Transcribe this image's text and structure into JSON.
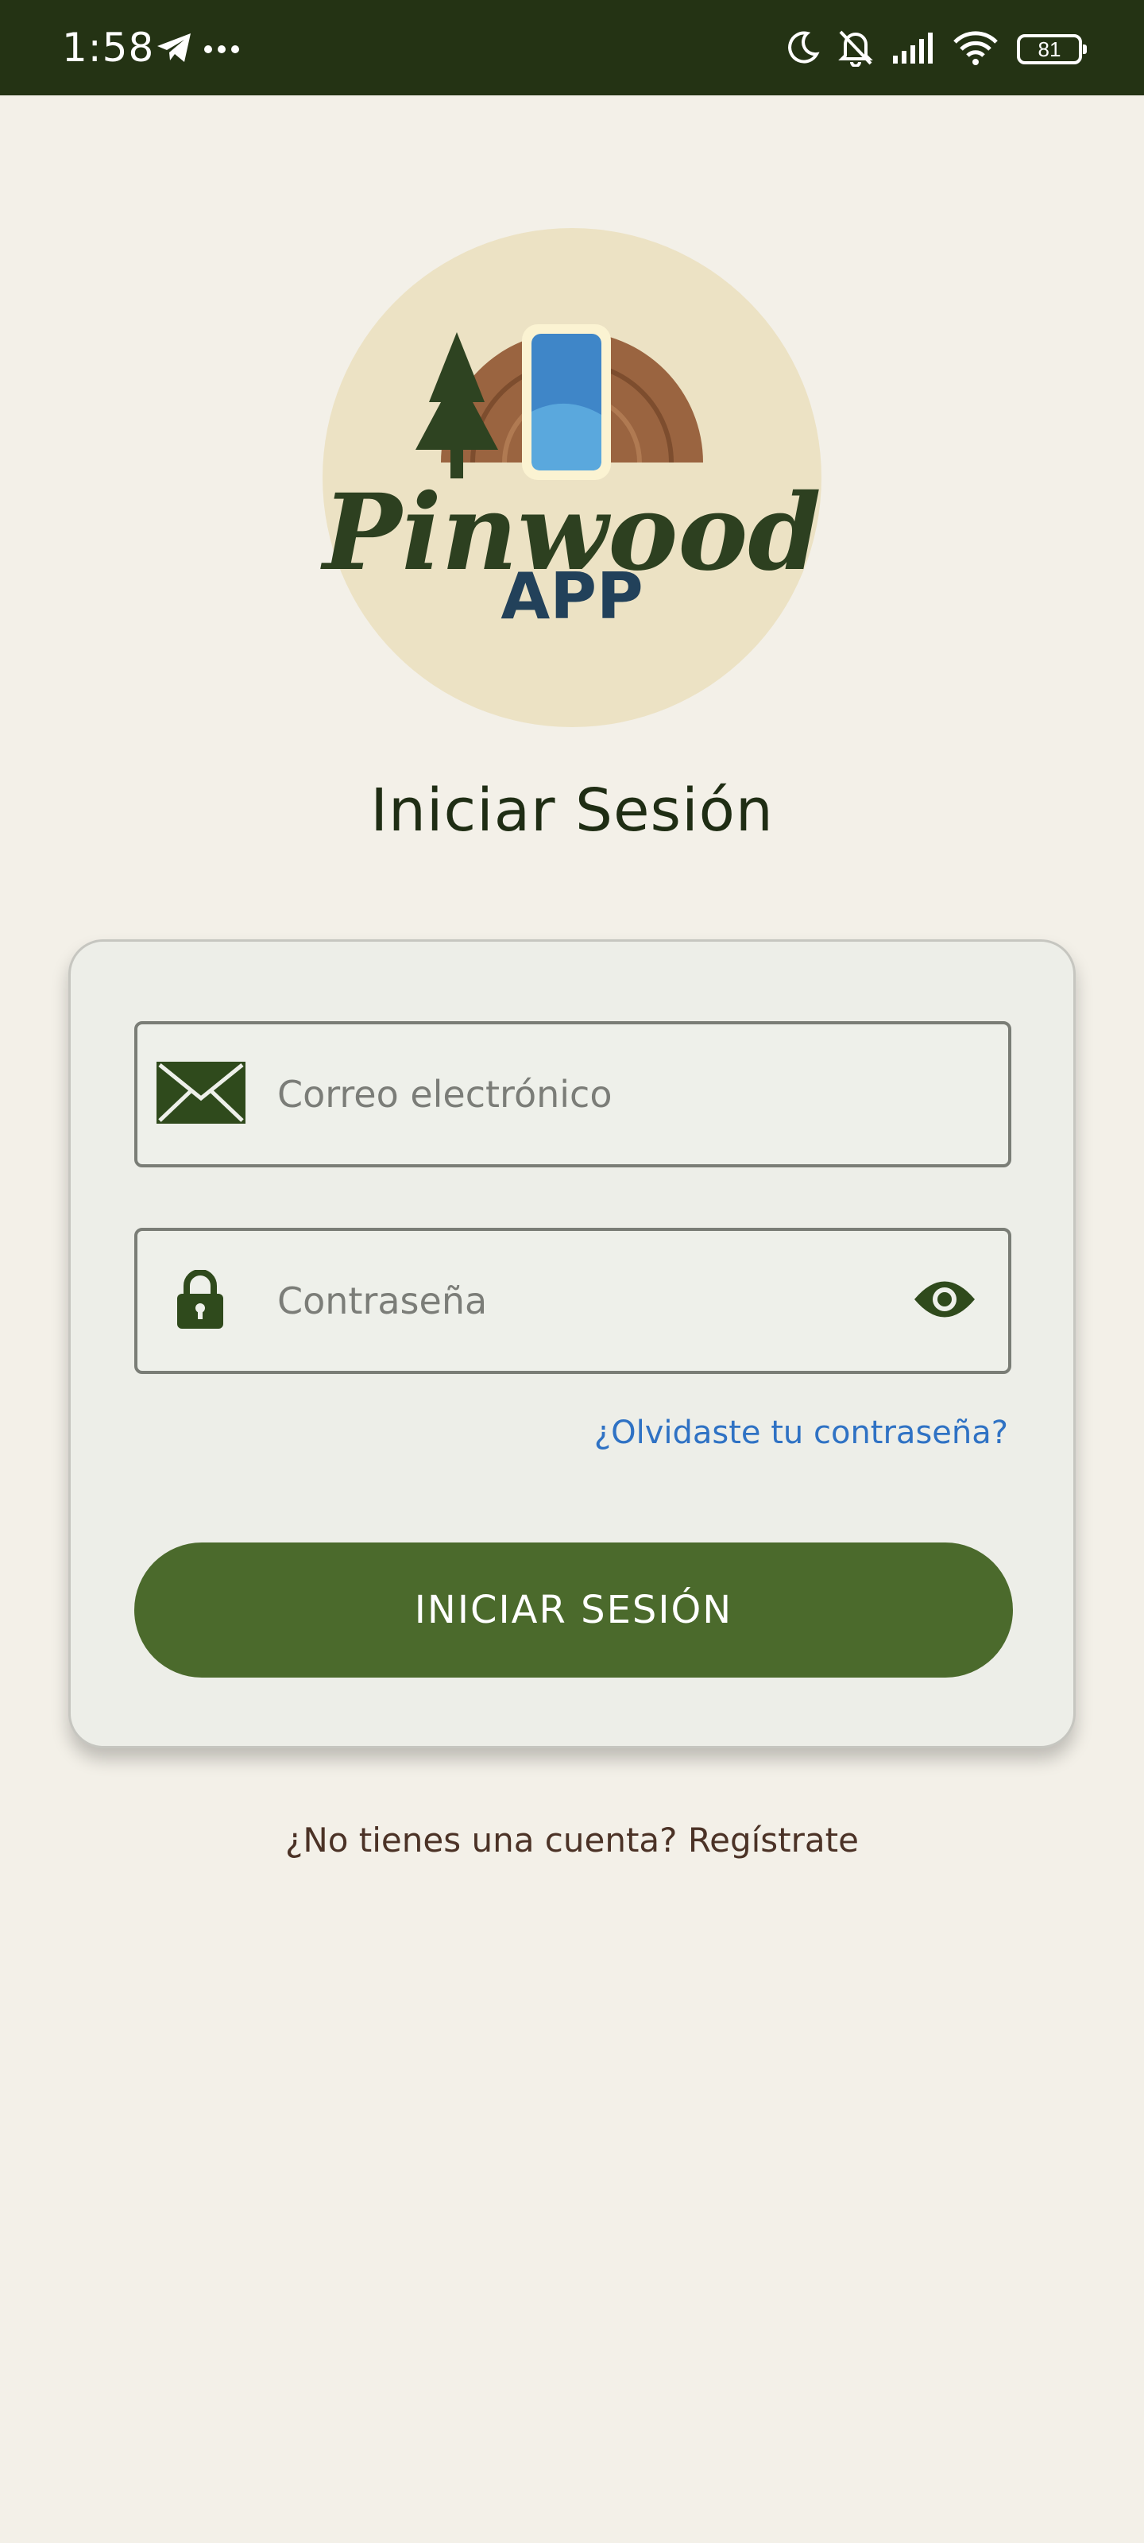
{
  "status_bar": {
    "time": "1:58",
    "battery_level": "81",
    "icons": [
      "telegram-icon",
      "more-dots-icon",
      "moon-icon",
      "bell-off-icon",
      "signal-icon",
      "wifi-icon",
      "battery-icon"
    ]
  },
  "logo": {
    "brand": "Pinwood",
    "subtitle": "APP"
  },
  "page": {
    "title": "Iniciar Sesión"
  },
  "form": {
    "email_placeholder": "Correo electrónico",
    "password_placeholder": "Contraseña",
    "forgot_password": "¿Olvidaste tu contraseña?",
    "submit_label": "INICIAR SESIÓN"
  },
  "footer": {
    "no_account": "¿No tienes una cuenta?",
    "register": "Regístrate"
  },
  "colors": {
    "background": "#f3f0e8",
    "status_bar": "#243314",
    "primary_green": "#4b6a2c",
    "icon_green": "#2f4a1c",
    "link_blue": "#2f72c4",
    "footer_text": "#4b3226"
  }
}
